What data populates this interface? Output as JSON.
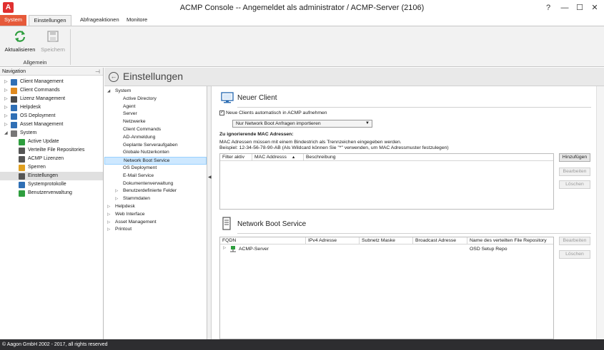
{
  "window": {
    "title": "ACMP Console -- Angemeldet als administrator / ACMP-Server (2106)",
    "logo_letter": "A",
    "help_glyph": "?",
    "min_glyph": "—",
    "max_glyph": "☐",
    "close_glyph": "✕"
  },
  "ribbon": {
    "tabs": {
      "system": "System",
      "einstellungen": "Einstellungen",
      "abfrageaktionen": "Abfrageaktionen",
      "monitore": "Monitore"
    },
    "buttons": {
      "refresh": "Aktualisieren",
      "save": "Speichern"
    },
    "group_label": "Allgemein"
  },
  "navigation": {
    "header": "Navigation",
    "items": [
      {
        "label": "Client Management",
        "icon": "monitor-icon",
        "color": "#2f6fb5"
      },
      {
        "label": "Client Commands",
        "icon": "commands-icon",
        "color": "#e08a1e"
      },
      {
        "label": "Lizenz Management",
        "icon": "license-icon",
        "color": "#4a4a4a"
      },
      {
        "label": "Helpdesk",
        "icon": "helpdesk-icon",
        "color": "#2f6fb5"
      },
      {
        "label": "OS Deployment",
        "icon": "os-deployment-icon",
        "color": "#2f6fb5"
      },
      {
        "label": "Asset Management",
        "icon": "asset-icon",
        "color": "#2f6fb5"
      },
      {
        "label": "System",
        "icon": "system-icon",
        "color": "#777777"
      },
      {
        "label": "Active Update",
        "icon": "active-update-icon",
        "color": "#2e9e3e"
      },
      {
        "label": "Verteilte File Repositories",
        "icon": "repository-icon",
        "color": "#555555"
      },
      {
        "label": "ACMP Lizenzen",
        "icon": "acmp-license-icon",
        "color": "#555555"
      },
      {
        "label": "Sperren",
        "icon": "lock-icon",
        "color": "#e0a020"
      },
      {
        "label": "Einstellungen",
        "icon": "settings-icon",
        "color": "#555555"
      },
      {
        "label": "Systemprotokolle",
        "icon": "log-icon",
        "color": "#2f6fb5"
      },
      {
        "label": "Benutzerverwaltung",
        "icon": "users-icon",
        "color": "#2e9e3e"
      }
    ]
  },
  "page": {
    "title": "Einstellungen"
  },
  "tree": {
    "items": [
      {
        "label": "System",
        "expander": "◢"
      },
      {
        "label": "Active Directory",
        "expander": ""
      },
      {
        "label": "Agent",
        "expander": ""
      },
      {
        "label": "Server",
        "expander": ""
      },
      {
        "label": "Netzwerke",
        "expander": ""
      },
      {
        "label": "Client Commands",
        "expander": ""
      },
      {
        "label": "AD-Anmeldung",
        "expander": ""
      },
      {
        "label": "Geplante Serveraufgaben",
        "expander": ""
      },
      {
        "label": "Globale Nutzerkonten",
        "expander": ""
      },
      {
        "label": "Network Boot Service",
        "expander": ""
      },
      {
        "label": "OS Deployment",
        "expander": ""
      },
      {
        "label": "E-Mail Service",
        "expander": ""
      },
      {
        "label": "Dokumentenverwaltung",
        "expander": ""
      },
      {
        "label": "Benutzerdefinierte Felder",
        "expander": "▷"
      },
      {
        "label": "Stammdaten",
        "expander": "▷"
      },
      {
        "label": "Helpdesk",
        "expander": "▷"
      },
      {
        "label": "Web Interface",
        "expander": "▷"
      },
      {
        "label": "Asset Management",
        "expander": "▷"
      },
      {
        "label": "Printout",
        "expander": "▷"
      }
    ]
  },
  "neuer_client": {
    "title": "Neuer Client",
    "checkbox_label": "Neue Clients automatisch in ACMP aufnehmen",
    "checkbox_glyph": "✓",
    "dropdown_value": "Nur Network Boot Anfragen importieren",
    "mac_heading": "Zu ignorierende MAC Adressen:",
    "mac_info_1": "MAC Adressen müssen mit einem Bindestrich als Trennzeichen eingegeben werden.",
    "mac_info_2": "Beispiel: 12-34-56-78-90-AB (Als Wildcard können Sie \"*\" verwenden, um MAC Adressmuster festzulegen)",
    "columns": [
      "Filter aktiv",
      "MAC Addresss",
      "Beschreibung"
    ],
    "sort_glyph": "▲",
    "buttons": {
      "add": "Hinzufügen",
      "edit": "Bearbeiten",
      "delete": "Löschen"
    }
  },
  "network_boot": {
    "title": "Network Boot Service",
    "columns": [
      "FQDN",
      "IPv4 Adresse",
      "Subnetz Maske",
      "Broadcast Adresse",
      "Name des verteilten File Repository"
    ],
    "rows": [
      {
        "fqdn": "ACMP-Server",
        "ipv4": "",
        "subnet": "",
        "broadcast": "",
        "repository": "OSD Setup Repo"
      }
    ],
    "buttons": {
      "edit": "Bearbeiten",
      "delete": "Löschen"
    }
  },
  "status": {
    "text": "© Aagon GmbH 2002 - 2017, all rights reserved"
  },
  "colors": {
    "system_tab": "#e65a3a",
    "selection": "#cde8ff",
    "statusbar": "#2d2d30"
  }
}
